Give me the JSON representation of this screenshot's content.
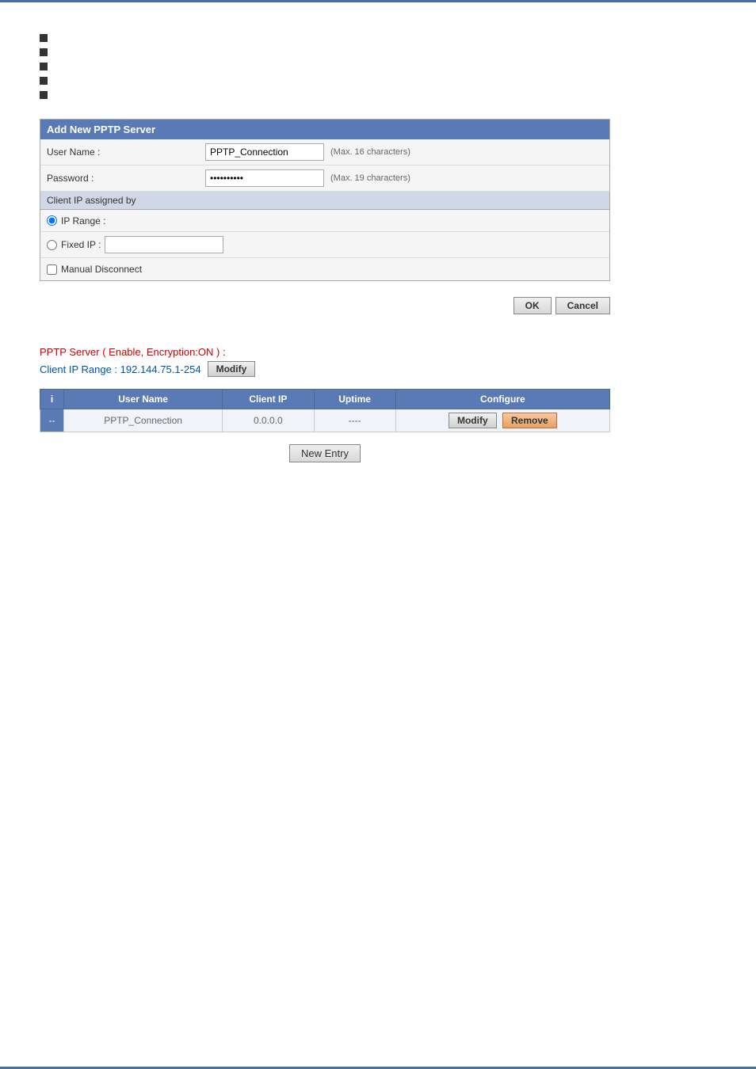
{
  "page": {
    "top_border_color": "#4a6fa5",
    "bottom_border_color": "#4a6fa5"
  },
  "bullets": {
    "items": [
      {
        "text": ""
      },
      {
        "text": ""
      },
      {
        "text": ""
      },
      {
        "text": ""
      },
      {
        "text": ""
      }
    ]
  },
  "form": {
    "header": "Add New PPTP Server",
    "username_label": "User Name :",
    "username_value": "PPTP_Connection",
    "username_hint": "(Max. 16 characters)",
    "password_label": "Password :",
    "password_value": "••••••••••",
    "password_hint": "(Max. 19 characters)",
    "client_ip_section": "Client IP assigned by",
    "ip_range_label": "IP Range :",
    "fixed_ip_label": "Fixed IP :",
    "fixed_ip_value": "",
    "manual_disconnect_label": "Manual Disconnect"
  },
  "buttons": {
    "ok_label": "OK",
    "cancel_label": "Cancel"
  },
  "pptp_status": {
    "line1": "PPTP Server ( Enable, Encryption:ON ) :",
    "line2_prefix": "Client IP Range : 192.144.75.1-254",
    "modify_label": "Modify"
  },
  "table": {
    "columns": [
      "i",
      "User Name",
      "Client IP",
      "Uptime",
      "Configure"
    ],
    "rows": [
      {
        "index": "--",
        "username": "PPTP_Connection",
        "client_ip": "0.0.0.0",
        "uptime": "----",
        "modify_label": "Modify",
        "remove_label": "Remove"
      }
    ]
  },
  "new_entry_button": "New  Entry"
}
